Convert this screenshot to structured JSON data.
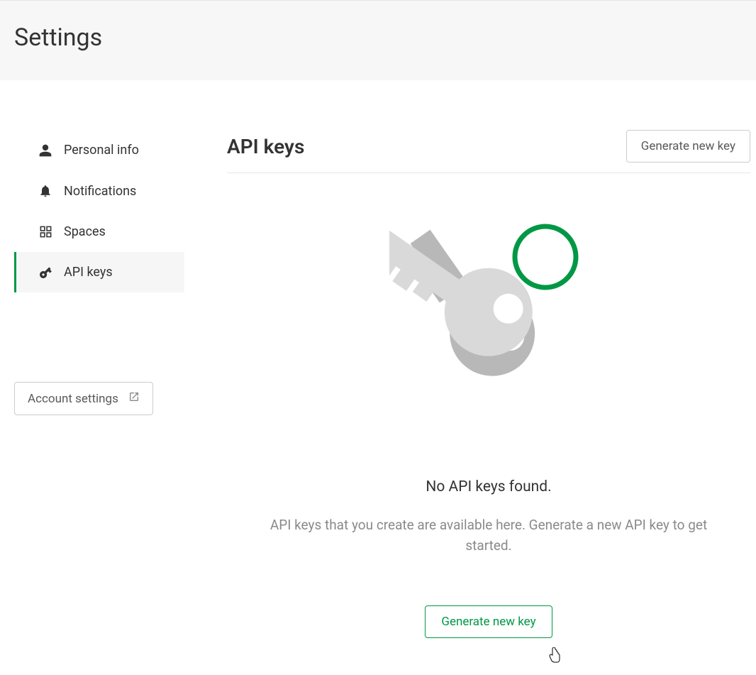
{
  "header": {
    "title": "Settings"
  },
  "sidebar": {
    "items": [
      {
        "label": "Personal info",
        "icon": "person-icon"
      },
      {
        "label": "Notifications",
        "icon": "bell-icon"
      },
      {
        "label": "Spaces",
        "icon": "grid-icon"
      },
      {
        "label": "API keys",
        "icon": "key-icon"
      }
    ],
    "account_settings_label": "Account settings"
  },
  "main": {
    "title": "API keys",
    "generate_button_label": "Generate new key",
    "empty_state": {
      "title": "No API keys found.",
      "description": "API keys that you create are available here. Generate a new API key to get started.",
      "button_label": "Generate new key"
    }
  },
  "colors": {
    "accent": "#009845"
  }
}
